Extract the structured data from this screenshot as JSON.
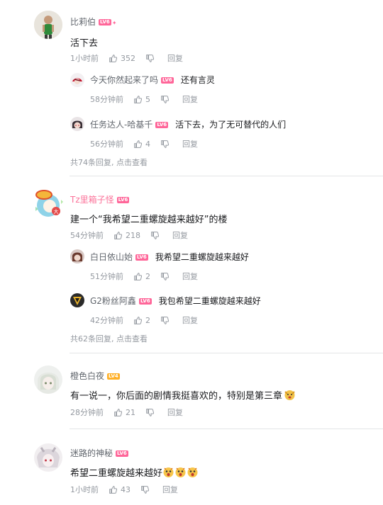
{
  "comments": [
    {
      "user": "比莉伯",
      "level": "LV6",
      "text": "活下去",
      "time": "1小时前",
      "likes": "352",
      "reply_label": "回复",
      "replies": [
        {
          "user": "今天你然起来了吗",
          "level": "LV6",
          "text": "还有言灵",
          "time": "58分钟前",
          "likes": "5",
          "reply_label": "回复"
        },
        {
          "user": "任务达人-哈基千",
          "level": "LV6",
          "text": "活下去，为了无可替代的人们",
          "time": "56分钟前",
          "likes": "4",
          "reply_label": "回复"
        }
      ],
      "more": "共74条回复, 点击查看"
    },
    {
      "user": "Tz里箱子怪",
      "level": "LV6",
      "text": "建一个“我希望二重螺旋越来越好”的楼",
      "time": "54分钟前",
      "likes": "218",
      "reply_label": "回复",
      "replies": [
        {
          "user": "白日依山始",
          "level": "LV6",
          "text": "我希望二重螺旋越来越好",
          "time": "51分钟前",
          "likes": "2",
          "reply_label": "回复"
        },
        {
          "user": "G2粉丝阿鑫",
          "level": "LV6",
          "text": "我包希望二重螺旋越来越好",
          "time": "42分钟前",
          "likes": "2",
          "reply_label": "回复"
        }
      ],
      "more": "共62条回复, 点击查看"
    },
    {
      "user": "橙色白夜",
      "level": "LV4",
      "text": "有一说一，你后面的剧情我挺喜欢的，特别是第三章",
      "time": "28分钟前",
      "likes": "21",
      "reply_label": "回复"
    },
    {
      "user": "迷路的神秘",
      "level": "LV6",
      "text": "希望二重螺旋越来越好",
      "time": "1小时前",
      "likes": "43",
      "reply_label": "回复"
    }
  ],
  "colors": {
    "username_default": "#61666d",
    "username_vip": "#fb7299",
    "level6": "#ff6699",
    "level4": "#ffb027",
    "meta": "#9499a0"
  },
  "icons": [
    "thumb-up-icon",
    "thumb-down-icon",
    "emoji-icon"
  ]
}
